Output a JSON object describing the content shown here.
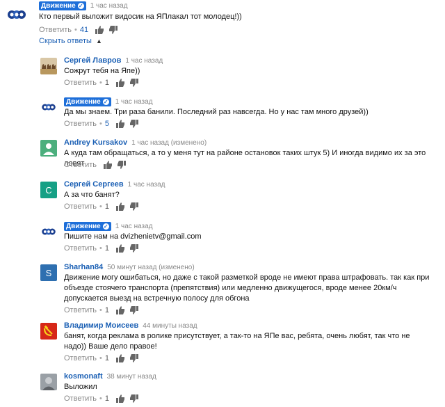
{
  "top_comment": {
    "author": "Движение",
    "time": "1 час назад",
    "text": "Кто первый выложит видосик на ЯПлакал тот молодец!))",
    "reply_label": "Ответить",
    "likes": "41"
  },
  "hide_replies_label": "Скрыть ответы",
  "replies": [
    {
      "author": "Сергей Лавров",
      "time": "1 час назад",
      "text": "Сожрут тебя на Япе))",
      "reply_label": "Ответить",
      "likes": "1",
      "avatar": "photo-camels"
    },
    {
      "author": "Движение",
      "time": "1 час назад",
      "text": "Да мы знаем. Три раза банили. Последний раз навсегда. Но у нас там много друзей))",
      "reply_label": "Ответить",
      "likes": "5",
      "avatar": "logo-circles",
      "verified": true
    },
    {
      "author": "Andrey Kursakov",
      "time": "1 час назад (изменено)",
      "text": "А куда там обращаться, а то у меня тут на районе остановок таких штук 5) И иногда видимо их за это ловят",
      "reply_label": "Ответить",
      "likes": "",
      "avatar": "default-person-green"
    },
    {
      "author": "Сергей Сергеев",
      "time": "1 час назад",
      "text": "А за что банят?",
      "reply_label": "Ответить",
      "likes": "1",
      "avatar": "letter-C-teal",
      "letter": "С"
    },
    {
      "author": "Движение",
      "time": "1 час назад",
      "text": "Пишите нам на dvizhenietv@gmail.com",
      "reply_label": "Ответить",
      "likes": "1",
      "avatar": "logo-circles",
      "verified": true
    },
    {
      "author": "Sharhan84",
      "time": "50 минут назад (изменено)",
      "text": "Движение могу ошибаться, но даже с такой разметкой вроде не имеют права штрафовать. так как при объезде стоячего транспорта (препятствия) или медленно движущегося, вроде менее 20км/ч допускается выезд на встречную полосу для обгона",
      "reply_label": "Ответить",
      "likes": "1",
      "avatar": "letter-S-blue",
      "letter": "S"
    },
    {
      "author": "Владимир Моисеев",
      "time": "44 минуты назад",
      "text": "банят, когда реклама в ролике присутствует, а так-то на ЯПе вас, ребята, очень любят, так что не надо)) Ваше дело правое!",
      "reply_label": "Ответить",
      "likes": "1",
      "avatar": "hammer-sickle"
    },
    {
      "author": "kosmonaft",
      "time": "38 минут назад",
      "text": "Выложил",
      "reply_label": "Ответить",
      "likes": "1",
      "avatar": "photo-portrait"
    }
  ],
  "colors": {
    "link": "#1a5fb4",
    "badge": "#1e6fd9",
    "muted": "#888888"
  }
}
